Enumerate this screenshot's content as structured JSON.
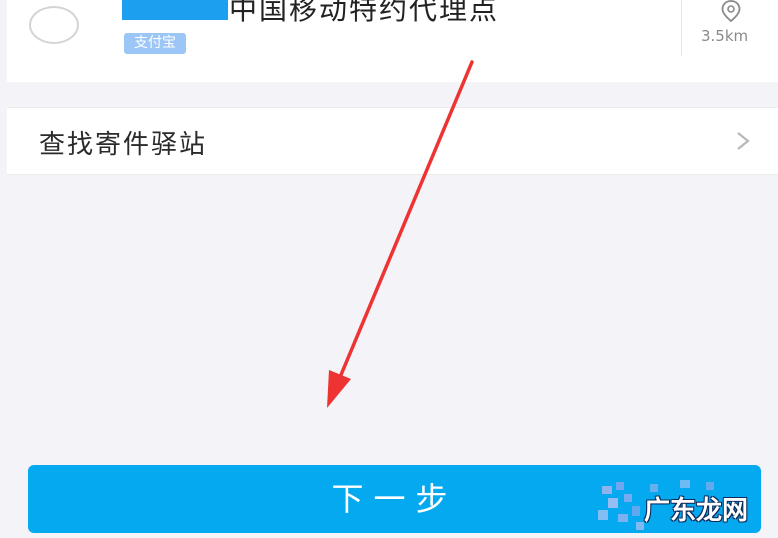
{
  "station": {
    "name": "中国移动特约代理点",
    "tag": "支付宝",
    "distance": "3.5km"
  },
  "find_station": {
    "label": "查找寄件驿站"
  },
  "next_button": {
    "label": "下一步"
  },
  "watermark": {
    "text": "广东龙网"
  },
  "colors": {
    "primary": "#05a9ef",
    "tag_bg": "#9cc6f6",
    "redaction": "#1d9ff0",
    "annotation_arrow": "#ee3333",
    "background": "#f4f3f8"
  },
  "icons": [
    "location-pin-icon",
    "chevron-right-icon",
    "radio-unchecked-icon",
    "annotation-arrow-icon"
  ]
}
